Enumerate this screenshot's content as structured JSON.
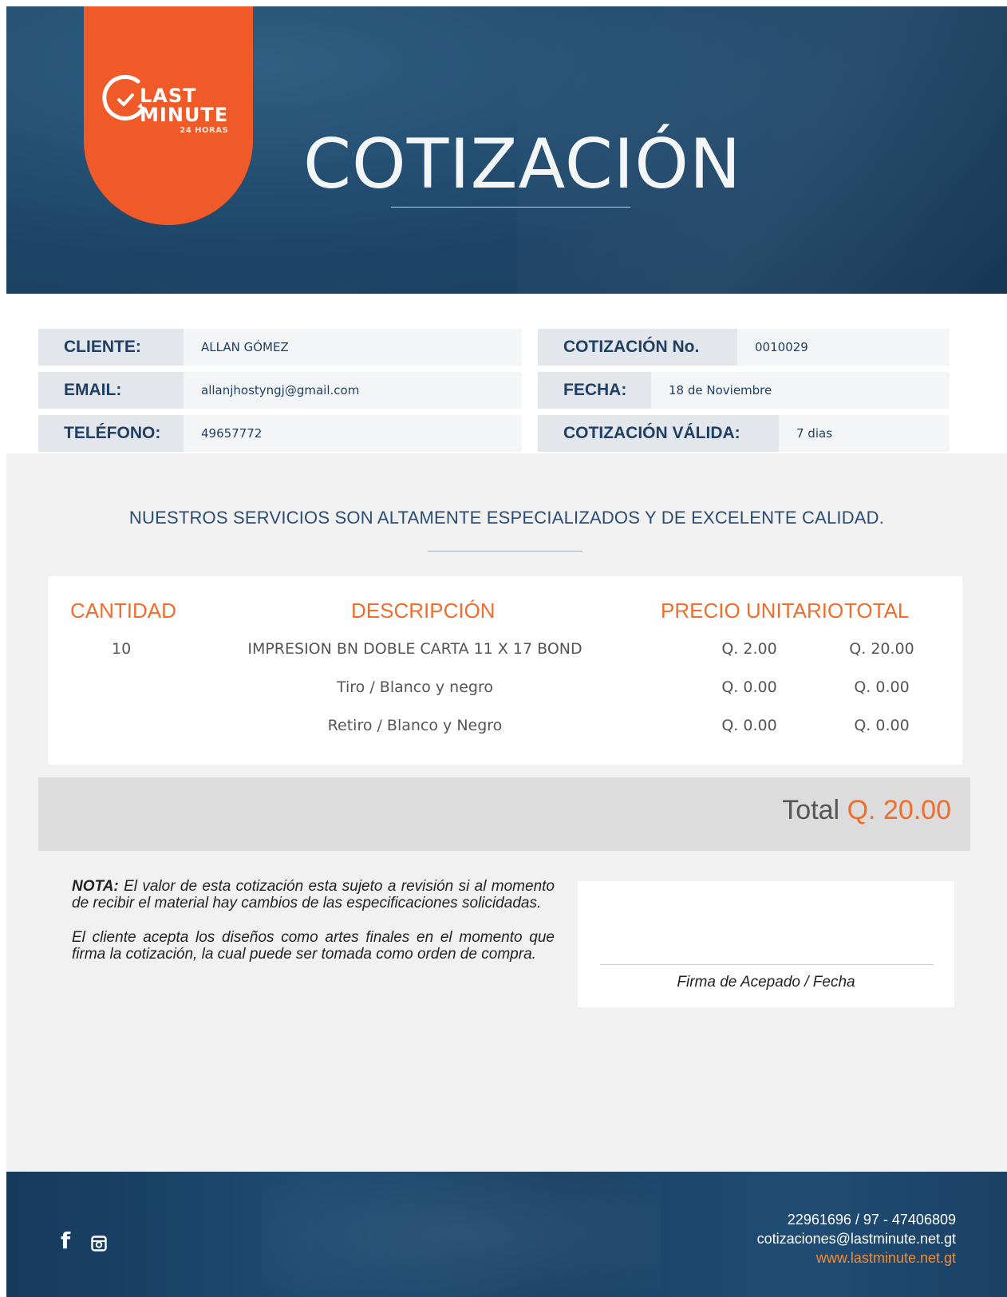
{
  "header": {
    "logo": {
      "line1": "LAST",
      "line2": "MINUTE",
      "line3": "24 HORAS"
    },
    "title": "COTIZACIÓN"
  },
  "client": {
    "cliente_label": "CLIENTE:",
    "cliente_value": "ALLAN GÓMEZ",
    "email_label": "EMAIL:",
    "email_value": "allanjhostyngj@gmail.com",
    "telefono_label": "TELÉFONO:",
    "telefono_value": "49657772"
  },
  "quote": {
    "numero_label": "COTIZACIÓN No.",
    "numero_value": "0010029",
    "fecha_label": "FECHA:",
    "fecha_value": "18 de Noviembre",
    "validez_label": "COTIZACIÓN VÁLIDA:",
    "validez_value": "7 dias"
  },
  "tagline": "NUESTROS SERVICIOS SON ALTAMENTE ESPECIALIZADOS Y DE EXCELENTE CALIDAD.",
  "table": {
    "headers": [
      "CANTIDAD",
      "DESCRIPCIÓN",
      "PRECIO UNITARIO",
      "TOTAL"
    ],
    "rows": [
      {
        "cantidad": "10",
        "descripcion": "IMPRESION BN DOBLE CARTA 11 X 17 BOND",
        "precio": "Q. 2.00",
        "total": "Q. 20.00"
      },
      {
        "cantidad": "",
        "descripcion": "Tiro / Blanco y negro",
        "precio": "Q. 0.00",
        "total": "Q. 0.00"
      },
      {
        "cantidad": "",
        "descripcion": "Retiro / Blanco y Negro",
        "precio": "Q. 0.00",
        "total": "Q. 0.00"
      }
    ]
  },
  "total": {
    "label": "Total",
    "amount": "Q. 20.00"
  },
  "note": {
    "bold": "NOTA:",
    "p1": "El valor de esta cotización esta sujeto a revisión si al momento de recibir el material hay cambios de las especificaciones solicidadas.",
    "p2": "El cliente acepta los diseños como artes finales en el momento que firma la cotización, la cual puede ser tomada como orden de compra."
  },
  "signature": {
    "label": "Firma de Acepado / Fecha"
  },
  "footer": {
    "phone": "22961696 / 97 - 47406809",
    "email": "cotizaciones@lastminute.net.gt",
    "web": "www.lastminute.net.gt",
    "icons": [
      "facebook-icon",
      "instagram-icon"
    ]
  },
  "colors": {
    "brand_orange": "#f05a28",
    "navy": "#1f3f66",
    "header_blue": "#244f72"
  }
}
